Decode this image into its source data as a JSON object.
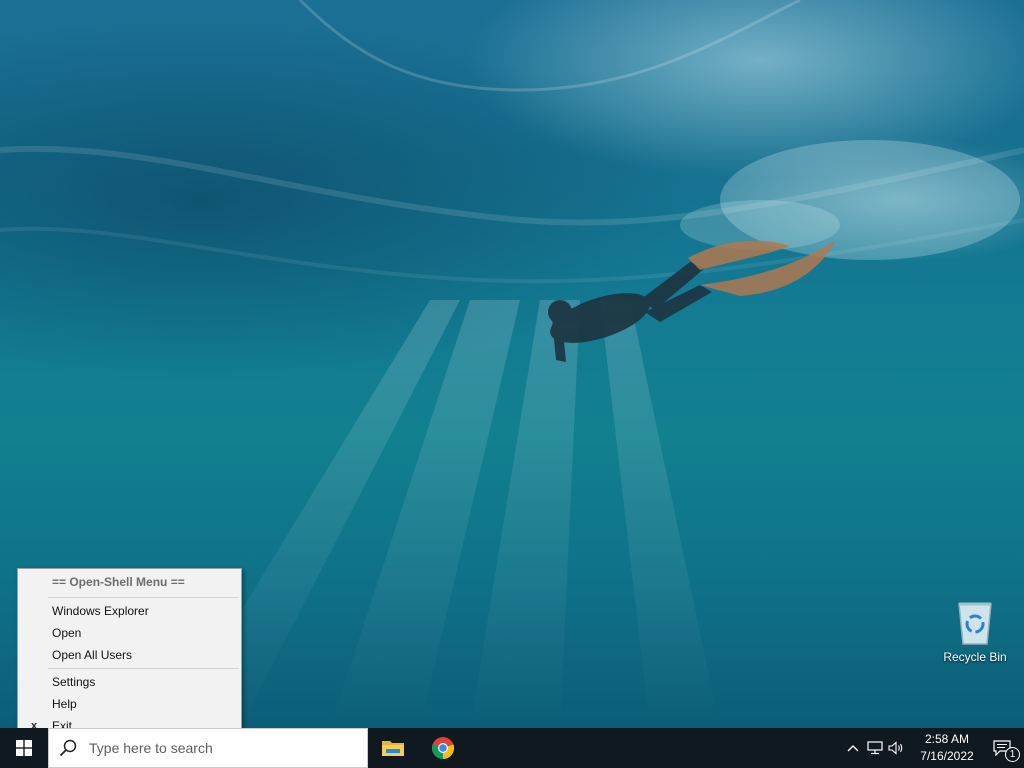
{
  "desktop": {
    "icons": [
      {
        "label": "Recycle Bin",
        "icon": "recycle-bin-icon"
      }
    ]
  },
  "context_menu": {
    "header": "== Open-Shell Menu ==",
    "items": [
      {
        "label": "Windows Explorer",
        "checked": false
      },
      {
        "label": "Open",
        "checked": false
      },
      {
        "label": "Open All Users",
        "checked": false
      },
      {
        "label": "Settings",
        "checked": false
      },
      {
        "label": "Help",
        "checked": false
      },
      {
        "label": "Exit",
        "checked": true,
        "mark": "x"
      }
    ]
  },
  "taskbar": {
    "start_icon": "windows-logo-icon",
    "search_placeholder": "Type here to search",
    "pinned_apps": [
      {
        "name": "file-explorer",
        "icon": "folder-icon"
      },
      {
        "name": "google-chrome",
        "icon": "chrome-icon"
      }
    ],
    "tray": {
      "icons": [
        "chevron-up-icon",
        "network-icon",
        "volume-icon"
      ],
      "time": "2:58 AM",
      "date": "7/16/2022",
      "notification_count": "1"
    }
  },
  "colors": {
    "taskbar_bg": "#101820",
    "menu_bg": "#f2f2f2",
    "chrome_red": "#db4437",
    "chrome_yellow": "#f4c20d",
    "chrome_green": "#0f9d58",
    "chrome_blue": "#4285f4"
  }
}
